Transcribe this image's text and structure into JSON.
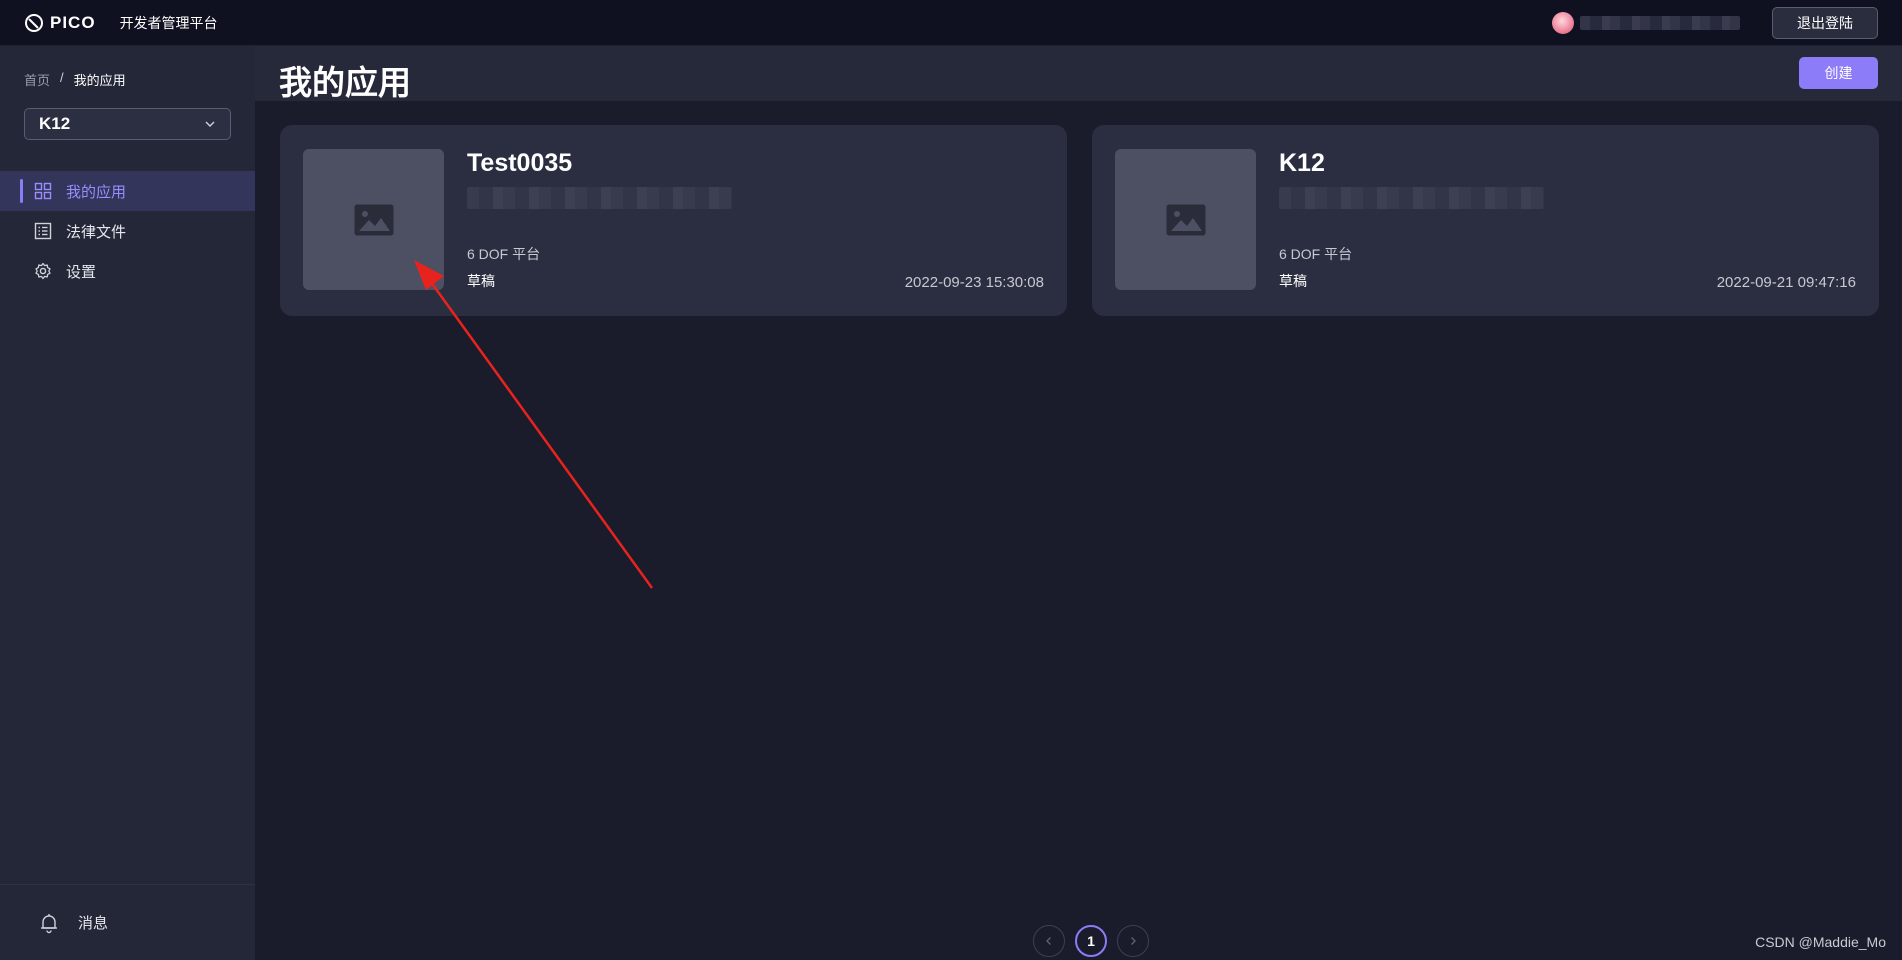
{
  "topbar": {
    "logo_text": "PICO",
    "platform_name": "开发者管理平台",
    "logout_label": "退出登陆"
  },
  "sidebar": {
    "breadcrumb": {
      "home": "首页",
      "separator": "/",
      "current": "我的应用"
    },
    "org_selected": "K12",
    "items": [
      {
        "label": "我的应用",
        "icon": "grid-icon",
        "active": true
      },
      {
        "label": "法律文件",
        "icon": "document-list-icon",
        "active": false
      },
      {
        "label": "设置",
        "icon": "gear-icon",
        "active": false
      }
    ],
    "bottom_label": "消息"
  },
  "main": {
    "title": "我的应用",
    "create_label": "创建",
    "apps": [
      {
        "name": "Test0035",
        "platform": "6 DOF 平台",
        "status": "草稿",
        "date": "2022-09-23 15:30:08"
      },
      {
        "name": "K12",
        "platform": "6 DOF 平台",
        "status": "草稿",
        "date": "2022-09-21 09:47:16"
      }
    ],
    "pagination": {
      "current": "1"
    }
  },
  "watermark": "CSDN @Maddie_Mo",
  "colors": {
    "accent": "#8d7cf7",
    "topbar_bg": "#0f1120",
    "sidebar_bg": "#242738",
    "page_bg": "#1a1c2b",
    "card_bg": "#2b2e40",
    "annotation_arrow": "#e8231e"
  }
}
